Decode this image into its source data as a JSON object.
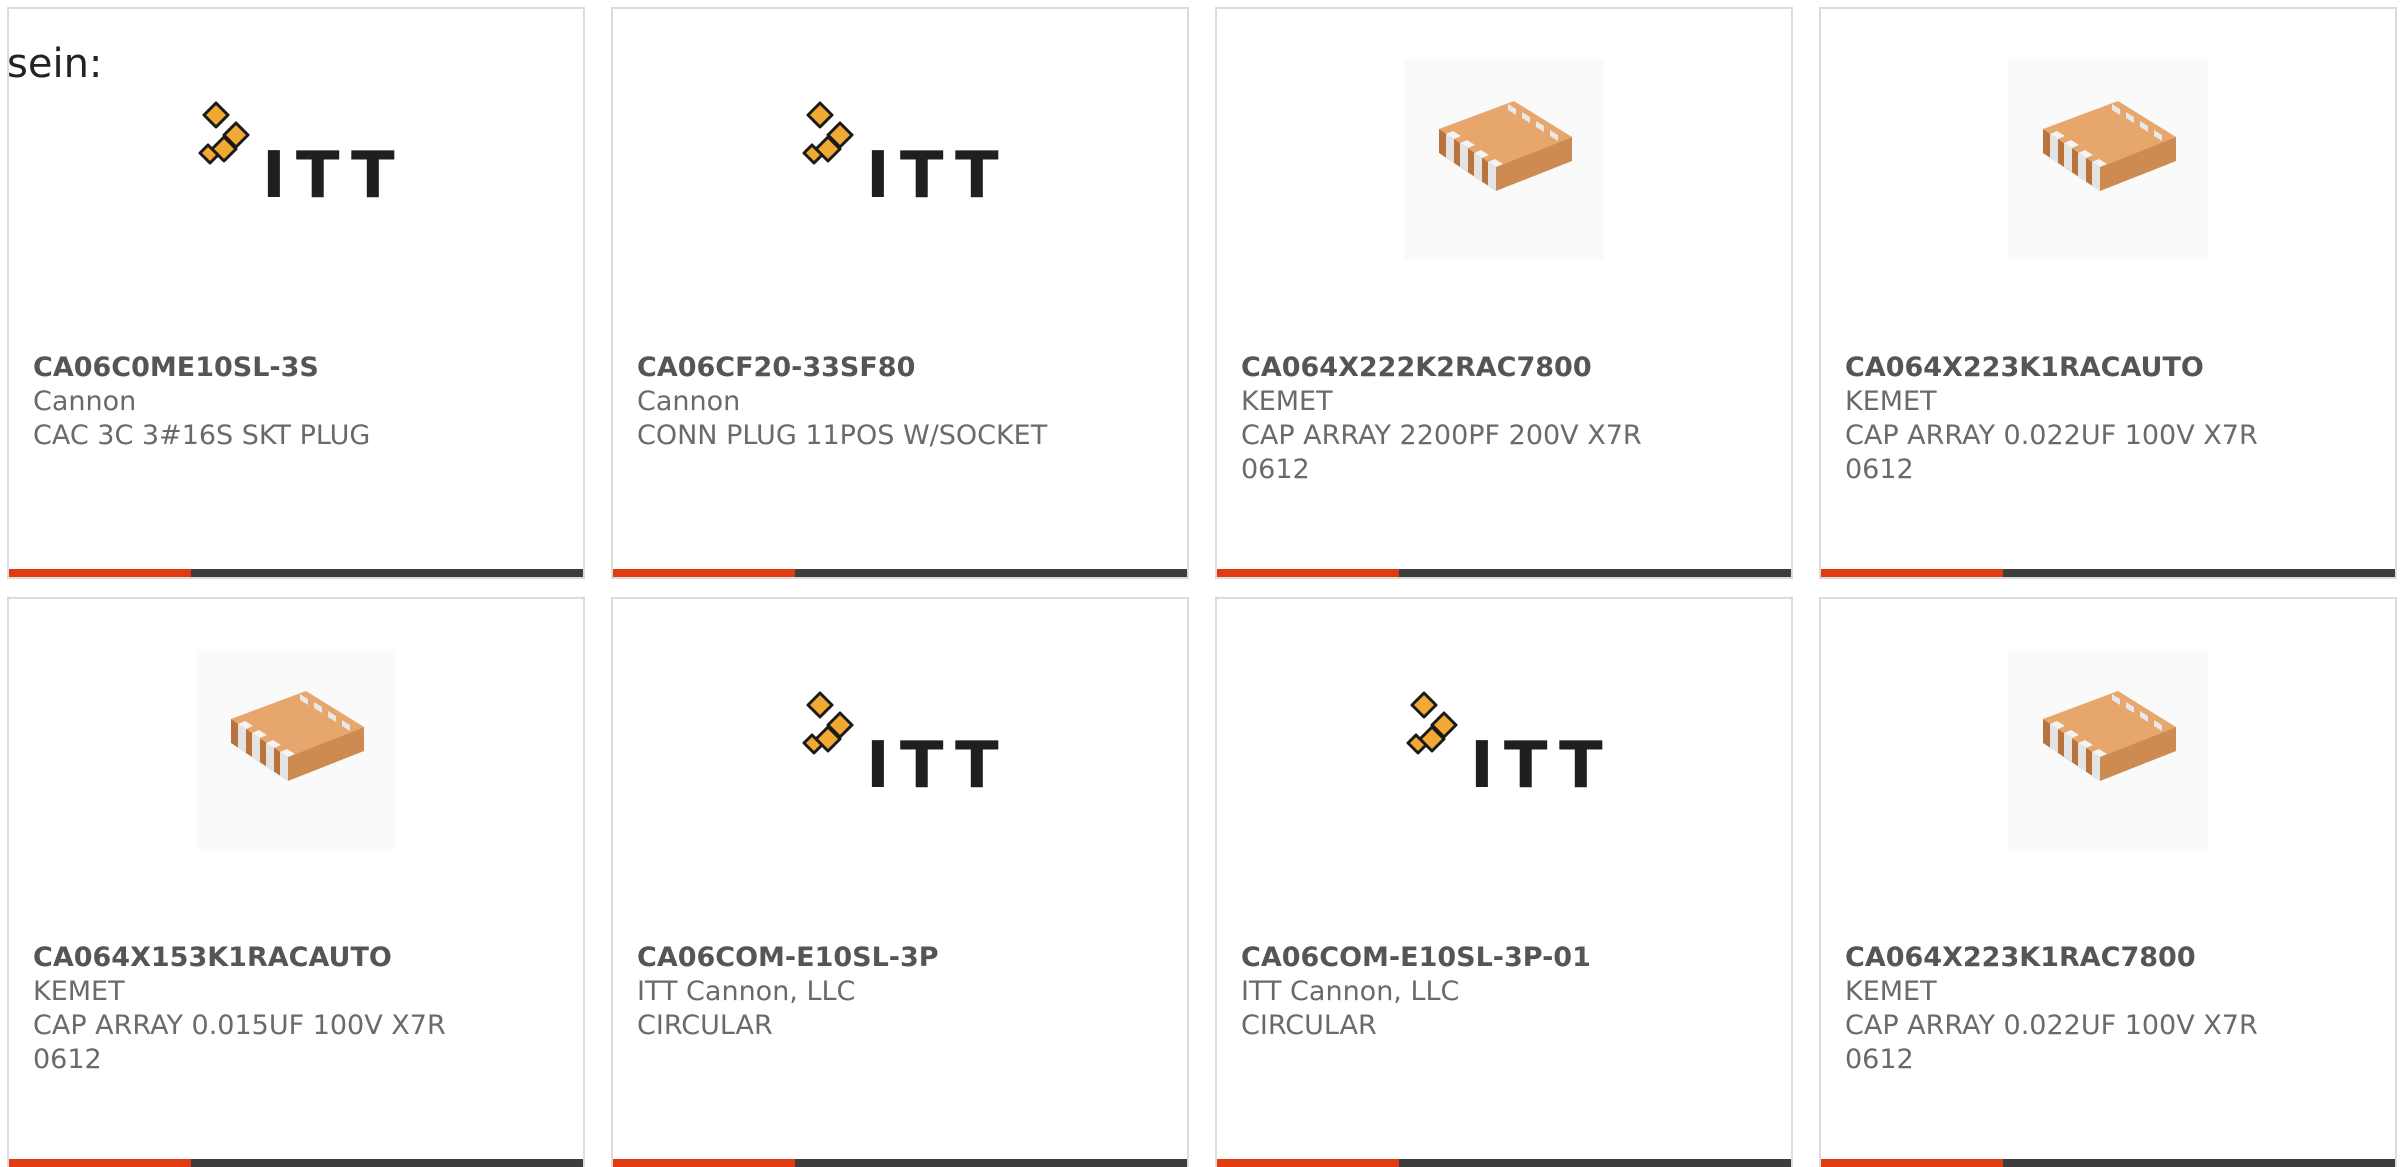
{
  "heading": "sein:",
  "brand": {
    "accent_color": "#e03c12",
    "bar_color": "#3d3d3d",
    "logo_text": "ITT"
  },
  "products": [
    {
      "part_number": "CA06C0ME10SL-3S",
      "manufacturer": "Cannon",
      "description": "CAC 3C 3#16S SKT PLUG",
      "image": "itt-logo"
    },
    {
      "part_number": "CA06CF20-33SF80",
      "manufacturer": "Cannon",
      "description": "CONN PLUG 11POS W/SOCKET",
      "image": "itt-logo"
    },
    {
      "part_number": "CA064X222K2RAC7800",
      "manufacturer": "KEMET",
      "description": "CAP ARRAY 2200PF 200V X7R 0612",
      "image": "capacitor-array-image"
    },
    {
      "part_number": "CA064X223K1RACAUTO",
      "manufacturer": "KEMET",
      "description": "CAP ARRAY 0.022UF 100V X7R 0612",
      "image": "capacitor-array-image"
    },
    {
      "part_number": "CA064X153K1RACAUTO",
      "manufacturer": "KEMET",
      "description": "CAP ARRAY 0.015UF 100V X7R 0612",
      "image": "capacitor-array-image"
    },
    {
      "part_number": "CA06COM-E10SL-3P",
      "manufacturer": "ITT Cannon, LLC",
      "description": "CIRCULAR",
      "image": "itt-logo"
    },
    {
      "part_number": "CA06COM-E10SL-3P-01",
      "manufacturer": "ITT Cannon, LLC",
      "description": "CIRCULAR",
      "image": "itt-logo"
    },
    {
      "part_number": "CA064X223K1RAC7800",
      "manufacturer": "KEMET",
      "description": "CAP ARRAY 0.022UF 100V X7R 0612",
      "image": "capacitor-array-image"
    }
  ]
}
